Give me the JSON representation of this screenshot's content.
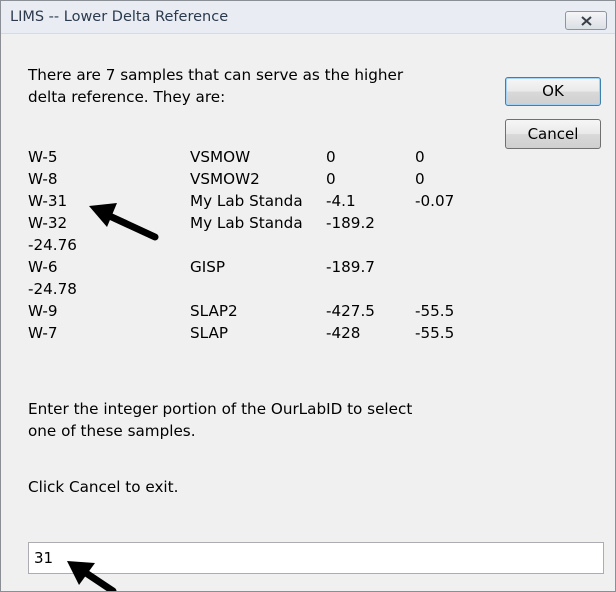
{
  "window": {
    "title": "LIMS -- Lower Delta Reference"
  },
  "message": {
    "line1": "There are 7 samples that can serve as the higher",
    "line2": "delta reference. They are:",
    "instruction1": "Enter the integer portion of the OurLabID to select",
    "instruction2": "one of these samples.",
    "cancel_note": "Click Cancel to exit."
  },
  "buttons": {
    "ok": "OK",
    "cancel": "Cancel"
  },
  "samples": [
    {
      "id": "W-5",
      "name": "VSMOW",
      "v1": "0",
      "v2": "0"
    },
    {
      "id": "W-8",
      "name": "VSMOW2",
      "v1": "0",
      "v2": "0"
    },
    {
      "id": "W-31",
      "name": "My Lab Standa",
      "v1": "-4.1",
      "v2": "-0.07"
    },
    {
      "id": "W-32",
      "name": "My Lab Standa",
      "v1": "-189.2",
      "v2": "-24.76"
    },
    {
      "id": "W-6",
      "name": "GISP",
      "v1": "-189.7",
      "v2": "-24.78"
    },
    {
      "id": "W-9",
      "name": "SLAP2",
      "v1": "-427.5",
      "v2": "-55.5"
    },
    {
      "id": "W-7",
      "name": "SLAP",
      "v1": "-428",
      "v2": "-55.5"
    }
  ],
  "input": {
    "value": "31"
  },
  "icons": {
    "close": "close-icon",
    "annotation_arrow": "arrow-icon"
  },
  "colors": {
    "dialog_bg": "#f0f0f0",
    "titlebar_bg": "#e9edf3",
    "title_text": "#2b3a4d",
    "default_button_border": "#3c7fb1"
  }
}
